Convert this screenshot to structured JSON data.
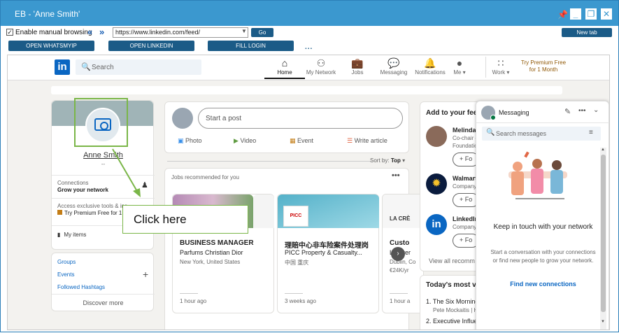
{
  "window": {
    "title": "EB - 'Anne Smith'",
    "pin_icon": "pin-icon",
    "controls": [
      "minimize-icon",
      "restore-icon",
      "close-icon"
    ]
  },
  "toolbar": {
    "manual_browsing_label": "Enable manual browsing",
    "manual_browsing_checked": true,
    "back_label": "«",
    "forward_label": "»",
    "url": "https://www.linkedin.com/feed/",
    "go_label": "Go",
    "new_tab_label": "New tab",
    "buttons": [
      "OPEN WHATSMYIP",
      "OPEN LINKEDIN",
      "FILL LOGIN"
    ],
    "more_label": "..."
  },
  "linkedin": {
    "logo": "in",
    "search_placeholder": "Search",
    "nav": [
      {
        "label": "Home",
        "icon": "home-icon",
        "active": true
      },
      {
        "label": "My Network",
        "icon": "network-icon",
        "active": false
      },
      {
        "label": "Jobs",
        "icon": "jobs-icon",
        "active": false
      },
      {
        "label": "Messaging",
        "icon": "messaging-icon",
        "active": false
      },
      {
        "label": "Notifications",
        "icon": "bell-icon",
        "active": false
      },
      {
        "label": "Me",
        "icon": "avatar-icon",
        "active": false
      },
      {
        "label": "Work",
        "icon": "grid-icon",
        "active": false
      }
    ],
    "premium_line1": "Try Premium Free",
    "premium_line2": "for 1 Month"
  },
  "profile": {
    "name": "Anne Smith",
    "headline": "--",
    "connections_label": "Connections",
    "grow_label": "Grow your network",
    "exclusive_label": "Access exclusive tools & ins",
    "premium_label": "Try Premium Free for 1",
    "my_items_label": "My items",
    "groups_label": "Groups",
    "events_label": "Events",
    "hashtags_label": "Followed Hashtags",
    "discover_label": "Discover more"
  },
  "annotation": {
    "click_here": "Click here"
  },
  "composer": {
    "start_post": "Start a post",
    "photo": "Photo",
    "video": "Video",
    "event": "Event",
    "article": "Write article"
  },
  "feed": {
    "sort_label": "Sort by:",
    "sort_value": "Top",
    "jobs_header": "Jobs recommended for you",
    "jobs": [
      {
        "title": "BUSINESS MANAGER",
        "company": "Parfums Christian Dior",
        "location": "New York, United States",
        "posted": "1 hour ago"
      },
      {
        "title": "理賠中心非车险案件处理岗",
        "company": "PICC Property & Casualty...",
        "location": "中国 重庆",
        "posted": "3 weeks ago"
      },
      {
        "title": "Custo",
        "company": "La Crer",
        "location": "Dublin, Co",
        "salary": "€24K/yr",
        "posted": "1 hour a"
      }
    ],
    "job2_banner_text": "PICC",
    "job3_banner_text": "LA CRÈ"
  },
  "right": {
    "add_feed": "Add to your fee",
    "suggestions": [
      {
        "name": "Melinda",
        "sub": "Co-chair o",
        "sub2": "Foundation",
        "follow": "+ Fo"
      },
      {
        "name": "Walmart",
        "sub": "Company",
        "follow": "+ Fo"
      },
      {
        "name": "LinkedIn",
        "sub": "Company",
        "follow": "+ Fo"
      }
    ],
    "view_all": "View all recomm",
    "todays_most": "Today's most vi",
    "news": [
      {
        "title": "1. The Six Morning",
        "sub": "Pete Mockaitis | Hi"
      },
      {
        "title": "2. Executive Influe",
        "sub": ""
      }
    ]
  },
  "messaging": {
    "title": "Messaging",
    "search_placeholder": "Search messages",
    "heading": "Keep in touch with your network",
    "body": "Start a conversation with your connections or find new people to grow your network.",
    "link": "Find new connections"
  }
}
